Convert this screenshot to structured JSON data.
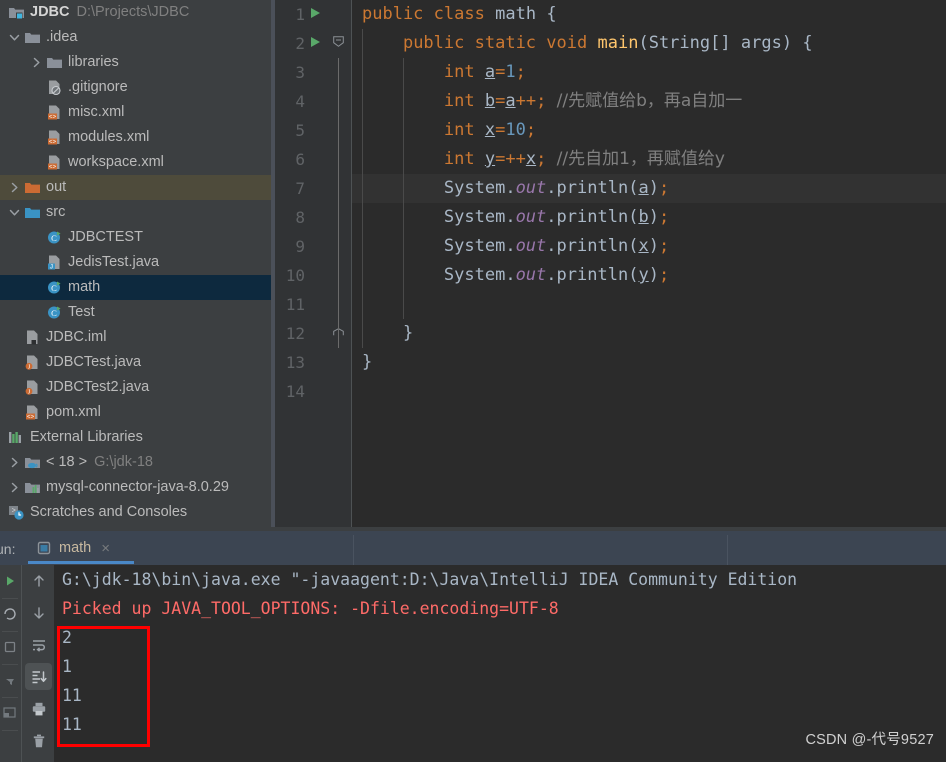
{
  "project": {
    "name": "JDBC",
    "path": "D:\\Projects\\JDBC"
  },
  "sidebar": {
    "items": [
      {
        "label": ".idea",
        "icon": "folder-icon",
        "arrow": "chevron-down",
        "indent": 0,
        "state": "none"
      },
      {
        "label": "libraries",
        "icon": "folder-icon",
        "arrow": "chevron-right",
        "indent": 1,
        "state": "none"
      },
      {
        "label": ".gitignore",
        "icon": "gitignore-file-icon",
        "arrow": "none",
        "indent": 1,
        "state": "none"
      },
      {
        "label": "misc.xml",
        "icon": "xml-file-icon",
        "arrow": "none",
        "indent": 1,
        "state": "none"
      },
      {
        "label": "modules.xml",
        "icon": "xml-file-icon",
        "arrow": "none",
        "indent": 1,
        "state": "none"
      },
      {
        "label": "workspace.xml",
        "icon": "xml-file-icon",
        "arrow": "none",
        "indent": 1,
        "state": "none"
      },
      {
        "label": "out",
        "icon": "folder-excluded-icon",
        "arrow": "chevron-right",
        "indent": 0,
        "state": "olive"
      },
      {
        "label": "src",
        "icon": "folder-source-icon",
        "arrow": "chevron-down",
        "indent": 0,
        "state": "none"
      },
      {
        "label": "JDBCTEST",
        "icon": "java-class-icon",
        "arrow": "none",
        "indent": 1,
        "state": "none"
      },
      {
        "label": "JedisTest.java",
        "icon": "java-file-icon",
        "arrow": "none",
        "indent": 1,
        "state": "none"
      },
      {
        "label": "math",
        "icon": "java-class-icon",
        "arrow": "none",
        "indent": 1,
        "state": "selected"
      },
      {
        "label": "Test",
        "icon": "java-class-icon",
        "arrow": "none",
        "indent": 1,
        "state": "none"
      },
      {
        "label": "JDBC.iml",
        "icon": "iml-file-icon",
        "arrow": "none",
        "indent": 0,
        "state": "none"
      },
      {
        "label": "JDBCTest.java",
        "icon": "java-orange-icon",
        "arrow": "none",
        "indent": 0,
        "state": "none"
      },
      {
        "label": "JDBCTest2.java",
        "icon": "java-orange-icon",
        "arrow": "none",
        "indent": 0,
        "state": "none"
      },
      {
        "label": "pom.xml",
        "icon": "maven-xml-icon",
        "arrow": "none",
        "indent": 0,
        "state": "none"
      },
      {
        "label": "External Libraries",
        "icon": "libraries-icon",
        "arrow": "none",
        "indent": -1,
        "state": "none"
      },
      {
        "label": "< 18 >",
        "icon": "jdk-icon",
        "arrow": "chevron-right",
        "indent": -1,
        "state": "none",
        "sublabel": "G:\\jdk-18"
      },
      {
        "label": "mysql-connector-java-8.0.29",
        "icon": "library-jar-icon",
        "arrow": "chevron-right",
        "indent": -1,
        "state": "none"
      },
      {
        "label": "Scratches and Consoles",
        "icon": "scratches-icon",
        "arrow": "none",
        "indent": -1,
        "state": "none"
      }
    ]
  },
  "editor": {
    "lines": [
      {
        "n": "1",
        "runnable": true,
        "fold": "open",
        "caret": false,
        "indent_guides": 0
      },
      {
        "n": "2",
        "runnable": true,
        "fold": "open",
        "caret": false,
        "indent_guides": 1
      },
      {
        "n": "3",
        "runnable": false,
        "fold": "none",
        "caret": false,
        "indent_guides": 2
      },
      {
        "n": "4",
        "runnable": false,
        "fold": "none",
        "caret": false,
        "indent_guides": 2
      },
      {
        "n": "5",
        "runnable": false,
        "fold": "none",
        "caret": false,
        "indent_guides": 2
      },
      {
        "n": "6",
        "runnable": false,
        "fold": "none",
        "caret": false,
        "indent_guides": 2
      },
      {
        "n": "7",
        "runnable": false,
        "fold": "none",
        "caret": true,
        "indent_guides": 2
      },
      {
        "n": "8",
        "runnable": false,
        "fold": "none",
        "caret": false,
        "indent_guides": 2
      },
      {
        "n": "9",
        "runnable": false,
        "fold": "none",
        "caret": false,
        "indent_guides": 2
      },
      {
        "n": "10",
        "runnable": false,
        "fold": "none",
        "caret": false,
        "indent_guides": 2
      },
      {
        "n": "11",
        "runnable": false,
        "fold": "none",
        "caret": false,
        "indent_guides": 2
      },
      {
        "n": "12",
        "runnable": false,
        "fold": "end",
        "caret": false,
        "indent_guides": 1
      },
      {
        "n": "13",
        "runnable": false,
        "fold": "none",
        "caret": false,
        "indent_guides": 0
      },
      {
        "n": "14",
        "runnable": false,
        "fold": "none",
        "caret": false,
        "indent_guides": 0
      }
    ],
    "code": [
      "public class math {",
      "    public static void main(String[] args) {",
      "        int a=1;",
      "        int b=a++; //先赋值给b，再a自加一",
      "        int x=10;",
      "        int y=++x; //先自加1，再赋值给y",
      "        System.out.println(a);",
      "        System.out.println(b);",
      "        System.out.println(x);",
      "        System.out.println(y);",
      "",
      "    }",
      "}",
      ""
    ]
  },
  "run_panel": {
    "label": "un:",
    "tab_name": "math",
    "close_label": "×",
    "toolbar": [
      {
        "name": "up-arrow-icon",
        "active": false
      },
      {
        "name": "down-arrow-icon",
        "active": false
      },
      {
        "name": "soft-wrap-icon",
        "active": false
      },
      {
        "name": "scroll-to-end-icon",
        "active": true
      },
      {
        "name": "print-icon",
        "active": false
      },
      {
        "name": "trash-icon",
        "active": false
      }
    ],
    "console": [
      {
        "text": "G:\\jdk-18\\bin\\java.exe \"-javaagent:D:\\Java\\IntelliJ IDEA Community Edition",
        "kind": "out"
      },
      {
        "text": "Picked up JAVA_TOOL_OPTIONS: -Dfile.encoding=UTF-8",
        "kind": "err"
      },
      {
        "text": "2",
        "kind": "out"
      },
      {
        "text": "1",
        "kind": "out"
      },
      {
        "text": "11",
        "kind": "out"
      },
      {
        "text": "11",
        "kind": "out"
      }
    ]
  },
  "annotation": {
    "box_color": "#ff0000"
  },
  "watermark": "CSDN @-代号9527"
}
